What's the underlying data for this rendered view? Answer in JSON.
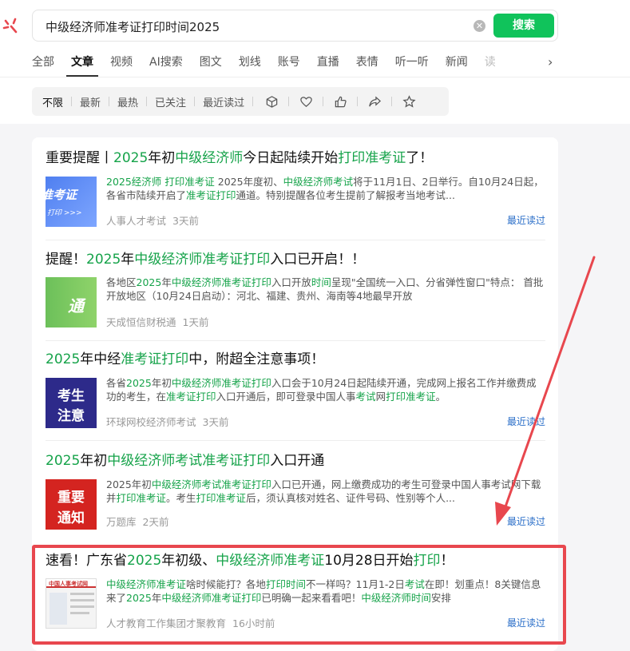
{
  "search": {
    "query": "中级经济师准考证打印时间2025",
    "button": "搜索"
  },
  "tabs": [
    "全部",
    "文章",
    "视频",
    "AI搜索",
    "图文",
    "划线",
    "账号",
    "直播",
    "表情",
    "听一听",
    "新闻",
    "读"
  ],
  "filters": [
    "不限",
    "最新",
    "最热",
    "已关注",
    "最近读过"
  ],
  "colors": {
    "accent": "#10c35b",
    "highlight": "#16a34a",
    "annotation": "#e8474e",
    "link": "#2a6ec8"
  },
  "results": [
    {
      "title": [
        "重要提醒丨",
        "2025",
        "年初",
        "中级经济师",
        "今日起陆续开始",
        "打印准考证",
        "了！"
      ],
      "snippet": [
        "2025经济师 打印准考证",
        " 2025年度初、",
        "中级经济师考试",
        "将于11月1日、2日举行。自10月24日起，各省市陆续开启了",
        "准考证打印",
        "通道。特别提醒各位考生提前了解报考当地考试..."
      ],
      "thumb_text": [
        "准考证",
        "打印 >>>"
      ],
      "source": "人事人才考试",
      "time": "3天前",
      "recent": "最近读过"
    },
    {
      "title": [
        "提醒！",
        "2025",
        "年",
        "中级经济师准考证打印",
        "入口已开启！！"
      ],
      "snippet": [
        "各地区",
        "2025",
        "年",
        "中级经济师准考证打印",
        "入口开放",
        "时间",
        "呈现\"全国统一入口、分省弹性窗口\"特点： 首批开放地区（10月24日启动）：河北、福建、贵州、海南等4地最早开放"
      ],
      "thumb_text": [
        "通"
      ],
      "source": "天成恒信财税通",
      "time": "1天前",
      "recent": ""
    },
    {
      "title": [
        "2025",
        "年中经",
        "准考证打印",
        "中，附超全注意事项！"
      ],
      "snippet": [
        "各省",
        "2025",
        "年初",
        "中级经济师准考证打印",
        "入口会于10月24日起陆续开通，完成网上报名工作并缴费成功的考生，在",
        "准考证打印",
        "入口开通后，即可登录中国人事",
        "考试",
        "网",
        "打印准考证",
        "。"
      ],
      "thumb_text": [
        "考生",
        "注意"
      ],
      "source": "环球网校经济师考试",
      "time": "3天前",
      "recent": "最近读过"
    },
    {
      "title": [
        "2025",
        "年初",
        "中级经济师考试准考证打印",
        "入口开通"
      ],
      "snippet": [
        "2025年初",
        "中级经济师考试准考证打印",
        "入口已开通，网上缴费成功的考生可登录中国人事考试网下载并",
        "打印准考证",
        "。考生",
        "打印准考证",
        "后，须认真核对姓名、证件号码、性别等个人..."
      ],
      "thumb_text": [
        "重要",
        "通知"
      ],
      "source": "万题库",
      "time": "2天前",
      "recent": "最近读过"
    },
    {
      "title": [
        "速看！广东省",
        "2025",
        "年初级、",
        "中级经济师准考证",
        "10月28日开始",
        "打印",
        "！"
      ],
      "snippet": [
        "中级经济师准考证",
        "啥时候能打？各地",
        "打印时间",
        "不一样吗？11月1-2日",
        "考试",
        "在即！划重点！8关键信息来了",
        "2025",
        "年",
        "中级经济师准考证打印",
        "已明确一起来看看吧！",
        "中级经济师",
        "时间",
        "安排"
      ],
      "thumb_text": [
        "中国人事考试网"
      ],
      "source": "人才教育工作集团才聚教育",
      "time": "16小时前",
      "recent": "最近读过"
    }
  ]
}
